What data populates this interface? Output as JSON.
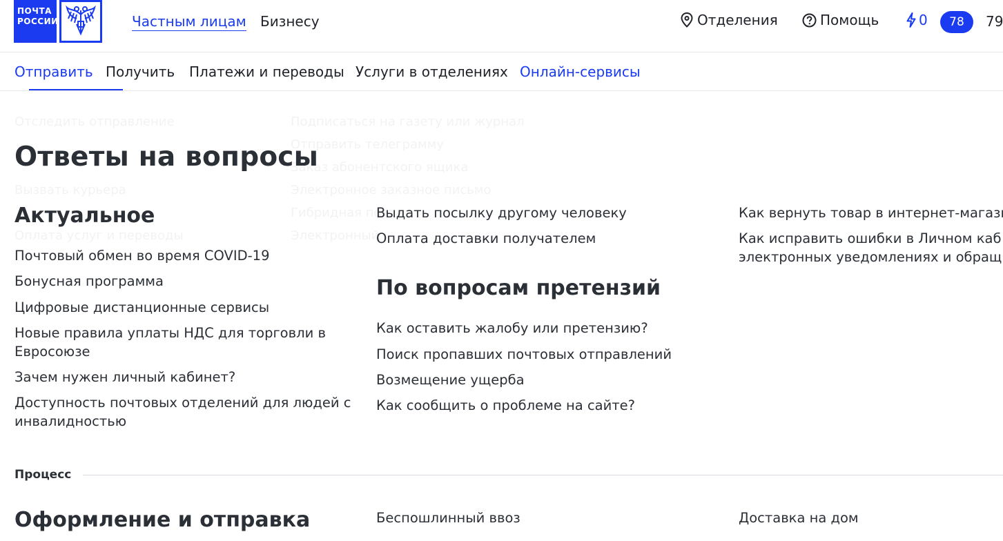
{
  "header": {
    "logo": {
      "line1": "ПОЧТА",
      "line2": "РОССИИ"
    },
    "audience_tabs": [
      "Частным лицам",
      "Бизнесу"
    ],
    "offices_label": "Отделения",
    "help_label": "Помощь",
    "bonus_count": "0",
    "badge_number": "78",
    "cut_number": "79"
  },
  "nav": {
    "items": [
      "Отправить",
      "Получить",
      "Платежи и переводы",
      "Услуги в отделениях",
      "Онлайн-сервисы"
    ]
  },
  "dropdown_ghost": {
    "col1": [
      "Отследить отправление",
      "Вызвать курьера",
      "Оплата услуг и переводы"
    ],
    "col2": [
      "Подписаться на газету или журнал",
      "Отправить телеграмму",
      "Заказ абонентского ящика",
      "Электронное заказное письмо",
      "Гибридная почта",
      "Электронный"
    ]
  },
  "page": {
    "title": "Ответы на вопросы",
    "sections": {
      "actual": {
        "heading": "Актуальное",
        "links": [
          "Почтовый обмен во время COVID-19",
          "Бонусная программа",
          "Цифровые дистанционные сервисы",
          "Новые правила уплаты НДС для торговли в Евросоюзе",
          "Зачем нужен личный кабинет?",
          "Доступность почтовых отделений для людей с инвалидностью"
        ]
      },
      "col2_top": {
        "links": [
          "Выдать посылку другому человеку",
          "Оплата доставки получателем"
        ]
      },
      "claims": {
        "heading": "По вопросам претензий",
        "links": [
          "Как оставить жалобу или претензию?",
          "Поиск пропавших почтовых отправлений",
          "Возмещение ущерба",
          "Как сообщить о проблеме на сайте?"
        ]
      },
      "col3_top": {
        "links": [
          "Как вернуть товар в интернет-магази",
          "Как исправить ошибки в Личном каб электронных уведомлениях и обращ"
        ]
      }
    },
    "process": {
      "label": "Процесс",
      "heading": "Оформление и отправка",
      "col2_link": "Беспошлинный ввоз",
      "col3_link": "Доставка на дом"
    }
  },
  "colors": {
    "brand": "#1a3bf0",
    "text": "#2b2f36",
    "divider": "#d7dae0"
  }
}
